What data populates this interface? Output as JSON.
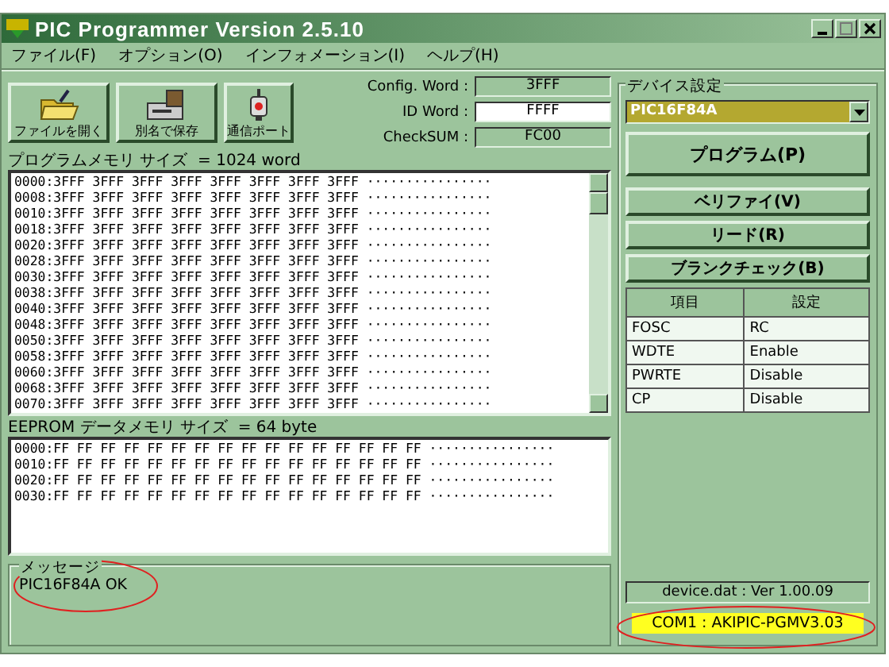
{
  "window": {
    "title": "PIC Programmer Version 2.5.10"
  },
  "menu": [
    "ファイル(F)",
    "オプション(O)",
    "インフォメーション(I)",
    "ヘルプ(H)"
  ],
  "toolbar": [
    {
      "label": "ファイルを開く",
      "kind": "open"
    },
    {
      "label": "別名で保存",
      "kind": "save"
    },
    {
      "label": "通信ポート",
      "kind": "port"
    }
  ],
  "words": [
    {
      "label": "Config. Word :",
      "value": "3FFF",
      "editable": false
    },
    {
      "label": "ID Word :",
      "value": "FFFF",
      "editable": true
    },
    {
      "label": "CheckSUM :",
      "value": "FC00",
      "editable": false
    }
  ],
  "program_memory": {
    "label": "プログラムメモリ サイズ  = 1024 word",
    "rows": [
      "0000:3FFF 3FFF 3FFF 3FFF 3FFF 3FFF 3FFF 3FFF ················",
      "0008:3FFF 3FFF 3FFF 3FFF 3FFF 3FFF 3FFF 3FFF ················",
      "0010:3FFF 3FFF 3FFF 3FFF 3FFF 3FFF 3FFF 3FFF ················",
      "0018:3FFF 3FFF 3FFF 3FFF 3FFF 3FFF 3FFF 3FFF ················",
      "0020:3FFF 3FFF 3FFF 3FFF 3FFF 3FFF 3FFF 3FFF ················",
      "0028:3FFF 3FFF 3FFF 3FFF 3FFF 3FFF 3FFF 3FFF ················",
      "0030:3FFF 3FFF 3FFF 3FFF 3FFF 3FFF 3FFF 3FFF ················",
      "0038:3FFF 3FFF 3FFF 3FFF 3FFF 3FFF 3FFF 3FFF ················",
      "0040:3FFF 3FFF 3FFF 3FFF 3FFF 3FFF 3FFF 3FFF ················",
      "0048:3FFF 3FFF 3FFF 3FFF 3FFF 3FFF 3FFF 3FFF ················",
      "0050:3FFF 3FFF 3FFF 3FFF 3FFF 3FFF 3FFF 3FFF ················",
      "0058:3FFF 3FFF 3FFF 3FFF 3FFF 3FFF 3FFF 3FFF ················",
      "0060:3FFF 3FFF 3FFF 3FFF 3FFF 3FFF 3FFF 3FFF ················",
      "0068:3FFF 3FFF 3FFF 3FFF 3FFF 3FFF 3FFF 3FFF ················",
      "0070:3FFF 3FFF 3FFF 3FFF 3FFF 3FFF 3FFF 3FFF ················"
    ]
  },
  "eeprom": {
    "label": "EEPROM データメモリ サイズ  = 64 byte",
    "rows": [
      "0000:FF FF FF FF FF FF FF FF FF FF FF FF FF FF FF FF ················",
      "0010:FF FF FF FF FF FF FF FF FF FF FF FF FF FF FF FF ················",
      "0020:FF FF FF FF FF FF FF FF FF FF FF FF FF FF FF FF ················",
      "0030:FF FF FF FF FF FF FF FF FF FF FF FF FF FF FF FF ················"
    ]
  },
  "message": {
    "label": "メッセージ",
    "text": "PIC16F84A OK"
  },
  "device": {
    "label": "デバイス設定",
    "selected_device": "PIC16F84A"
  },
  "actions": [
    {
      "label": "プログラム(P)",
      "kind": "large"
    },
    {
      "label": "ベリファイ(V)",
      "kind": "small"
    },
    {
      "label": "リード(R)",
      "kind": "small"
    },
    {
      "label": "ブランクチェック(B)",
      "kind": "small"
    }
  ],
  "settings": {
    "columns": [
      "項目",
      "設定"
    ],
    "rows": [
      [
        "FOSC",
        "RC"
      ],
      [
        "WDTE",
        "Enable"
      ],
      [
        "PWRTE",
        "Disable"
      ],
      [
        "CP",
        "Disable"
      ]
    ]
  },
  "device_dat": "device.dat : Ver 1.00.09",
  "com_status": "COM1 : AKIPIC-PGMV3.03"
}
